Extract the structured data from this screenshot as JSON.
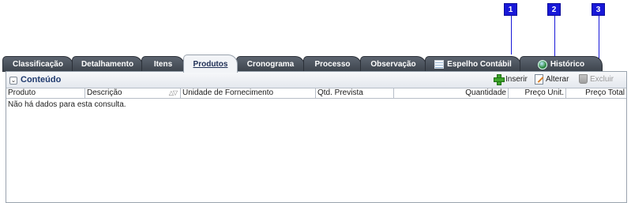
{
  "callouts": [
    "1",
    "2",
    "3"
  ],
  "tabs": [
    {
      "label": "Classificação"
    },
    {
      "label": "Detalhamento"
    },
    {
      "label": "Itens"
    },
    {
      "label": "Produtos",
      "active": true
    },
    {
      "label": "Cronograma"
    },
    {
      "label": "Processo"
    },
    {
      "label": "Observação"
    },
    {
      "label": "Espelho Contábil",
      "icon": "spreadsheet-icon"
    },
    {
      "label": "Histórico",
      "icon": "globe-icon"
    }
  ],
  "panel": {
    "title": "Conteúdo",
    "actions": {
      "insert": "Inserir",
      "edit": "Alterar",
      "delete": "Excluir"
    }
  },
  "grid": {
    "columns": [
      "Produto",
      "Descrição",
      "Unidade de Fornecimento",
      "Qtd. Prevista",
      "Quantidade",
      "Preço Unit.",
      "Preço Total"
    ],
    "empty_message": "Não há dados para esta consulta."
  },
  "colors": {
    "callout": "#1818d8",
    "tab_dark": "#3c434c",
    "title": "#1f3a6e"
  }
}
